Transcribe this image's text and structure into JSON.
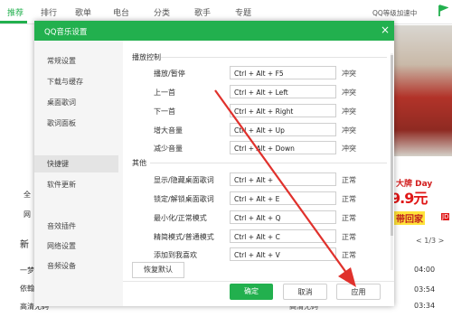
{
  "app": {
    "tabs": [
      "推荐",
      "排行",
      "歌单",
      "电台",
      "分类",
      "歌手",
      "专题"
    ],
    "vip_text": "QQ等级加速中",
    "left_menu": [
      "全",
      "网"
    ],
    "new_label": "新",
    "rows": [
      "一梦",
      "依翰",
      "高清无码"
    ],
    "times": [
      "04:00",
      "03:54",
      "03:34"
    ],
    "pager": "< 1/3 >",
    "ad": {
      "big": "大牌 Day",
      "price": "9.9元",
      "gift": "带回家",
      "jd": "JD"
    },
    "bottom_text": "高清无码"
  },
  "dialog": {
    "title": "QQ音乐设置",
    "close_icon": "×",
    "sidebar": {
      "items": [
        "常规设置",
        "下载与缓存",
        "桌面歌词",
        "歌词面板",
        "快捷键",
        "软件更新",
        "音效插件",
        "网络设置",
        "音频设备"
      ],
      "active_index": 4
    },
    "section_playback": "播放控制",
    "section_other": "其他",
    "shortcuts": [
      {
        "label": "播放/暂停",
        "key": "Ctrl + Alt + F5",
        "status": "冲突"
      },
      {
        "label": "上一首",
        "key": "Ctrl + Alt + Left",
        "status": "冲突"
      },
      {
        "label": "下一首",
        "key": "Ctrl + Alt + Right",
        "status": "冲突"
      },
      {
        "label": "增大音量",
        "key": "Ctrl + Alt + Up",
        "status": "冲突"
      },
      {
        "label": "减少音量",
        "key": "Ctrl + Alt + Down",
        "status": "冲突"
      },
      {
        "label": "显示/隐藏桌面歌词",
        "key": "Ctrl + Alt +",
        "status": "正常"
      },
      {
        "label": "锁定/解锁桌面歌词",
        "key": "Ctrl + Alt + E",
        "status": "正常"
      },
      {
        "label": "最小化/正常模式",
        "key": "Ctrl + Alt + Q",
        "status": "正常"
      },
      {
        "label": "精简模式/普通模式",
        "key": "Ctrl + Alt + C",
        "status": "正常"
      },
      {
        "label": "添加到我喜欢",
        "key": "Ctrl + Alt + V",
        "status": "正常"
      }
    ],
    "restore_label": "恢复默认",
    "ok_label": "确定",
    "cancel_label": "取消",
    "apply_label": "应用"
  },
  "colors": {
    "accent": "#22b04e",
    "arrow": "#e0312c"
  }
}
